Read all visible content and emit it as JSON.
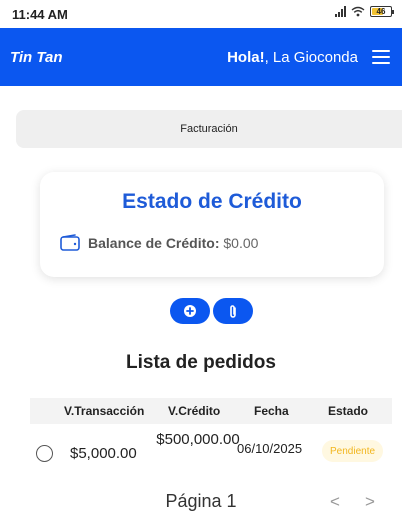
{
  "status_bar": {
    "time": "11:44 AM",
    "battery": "46"
  },
  "header": {
    "brand": "Tin Tan",
    "greeting_prefix": "Hola!",
    "greeting_name": ", La Gioconda",
    "menu_icon": "hamburger-menu-icon"
  },
  "billing": {
    "label": "Facturación"
  },
  "credit_card": {
    "title": "Estado de Crédito",
    "icon": "wallet-icon",
    "balance_label": "Balance de Crédito:",
    "balance_value": "$0.00"
  },
  "actions": [
    {
      "icon": "plus-circle-icon"
    },
    {
      "icon": "paperclip-icon"
    }
  ],
  "orders": {
    "title": "Lista de pedidos",
    "columns": [
      "V.Transacción",
      "V.Crédito",
      "Fecha",
      "Estado"
    ],
    "rows": [
      {
        "transaction_value": "$5,000.00",
        "credit_value": "$500,000.00",
        "date": "06/10/2025",
        "status": "Pendiente"
      }
    ]
  },
  "pagination": {
    "label": "Página 1",
    "prev": "<",
    "next": ">"
  },
  "colors": {
    "primary": "#0b57f0",
    "title_blue": "#1e5bd8",
    "pending_text": "#f2b61f",
    "pending_bg": "#fff8e1"
  }
}
